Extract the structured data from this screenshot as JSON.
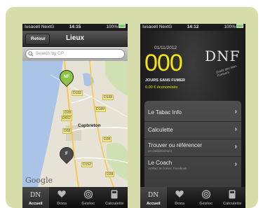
{
  "left_phone": {
    "status": {
      "carrier": "Iusacell NextG",
      "time": "14:15",
      "battery": "100%"
    },
    "navbar": {
      "back_label": "Retour",
      "title": "Lieux"
    },
    "search": {
      "placeholder": "Search by CP"
    },
    "map": {
      "town": "Capbreton",
      "roads": [
        "D152",
        "D28",
        "D652",
        "D133",
        "D189",
        "D28",
        "D28",
        "D152",
        "D28"
      ],
      "pins": [
        "NF",
        "F"
      ],
      "attribution": "Google"
    }
  },
  "right_phone": {
    "status": {
      "carrier": "Iusacell NextG",
      "time": "14:12",
      "battery": "100%"
    },
    "date": "01/11/2012",
    "counter": "000",
    "days_label": "JOURS SANS FUMER",
    "money_saved": "0.00 € économisés",
    "logo": {
      "text": "DNF",
      "tagline": "Droits des Non-Fumeurs"
    },
    "menu": [
      {
        "title": "Le Tabac Info",
        "subtitle": ""
      },
      {
        "title": "Calculette",
        "subtitle": ""
      },
      {
        "title": "Trouver ou référencer",
        "subtitle": "un établissement"
      },
      {
        "title": "Le Coach",
        "subtitle": "Arrêtez de fumer, Facebook"
      }
    ]
  },
  "tabbar": [
    {
      "label": "Accueil",
      "icon": "dnf-logo-icon",
      "active": true
    },
    {
      "label": "Dons",
      "icon": "heart-icon",
      "active": false
    },
    {
      "label": "Géoloc",
      "icon": "target-icon",
      "active": false
    },
    {
      "label": "Calculette",
      "icon": "calculator-icon",
      "active": false
    }
  ],
  "colors": {
    "frame": "#d6dcaa",
    "accent_yellow": "#f4e315",
    "pin_green": "#8cc63f"
  }
}
